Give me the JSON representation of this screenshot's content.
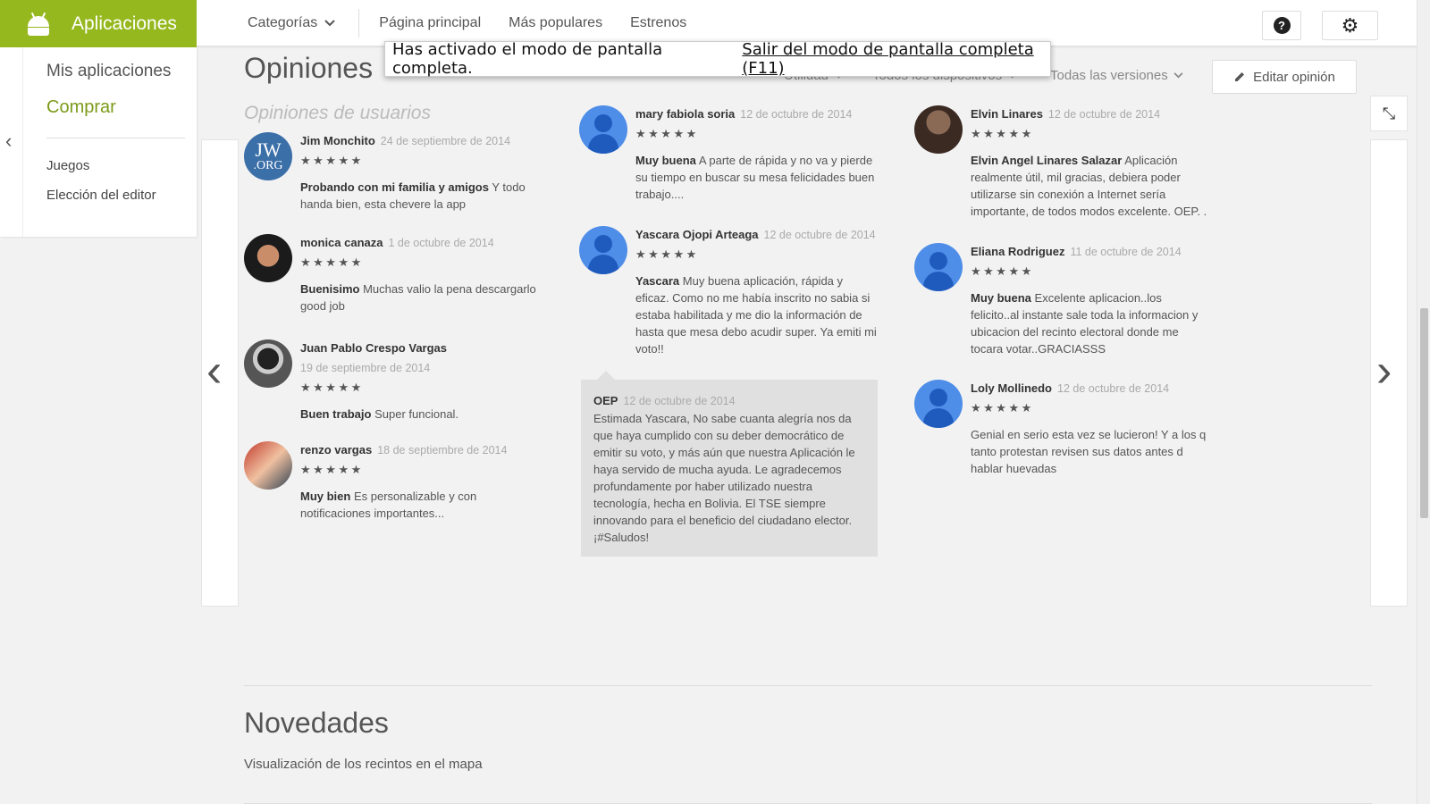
{
  "header": {
    "app_title": "Aplicaciones",
    "nav": {
      "categories": "Categorías",
      "home": "Página principal",
      "popular": "Más populares",
      "new": "Estrenos"
    },
    "help_icon": "?",
    "gear_icon": "⚙"
  },
  "sidebar": {
    "my_apps": "Mis aplicaciones",
    "shop": "Comprar",
    "games": "Juegos",
    "editors_choice": "Elección del editor"
  },
  "reviews": {
    "title": "Opiniones",
    "filters": {
      "sort": "Utilidad",
      "devices": "Todos los dispositivos",
      "versions": "Todas las versiones"
    },
    "edit_button": "Editar opinión",
    "users_heading": "Opiniones de usuarios",
    "stars": "★★★★★",
    "items": [
      {
        "name": "Jim Monchito",
        "date": "24 de septiembre de 2014",
        "lead": "Probando con mi familia y amigos",
        "text": "Y todo handa bien, esta chevere la app",
        "avatar_l1": "JW",
        "avatar_l2": ".ORG"
      },
      {
        "name": "monica canaza",
        "date": "1 de octubre de 2014",
        "lead": "Buenisimo",
        "text": "Muchas valio la pena descargarlo good job"
      },
      {
        "name": "Juan Pablo Crespo Vargas",
        "date": "19 de septiembre de 2014",
        "lead": "Buen trabajo",
        "text": "Super funcional."
      },
      {
        "name": "renzo vargas",
        "date": "18 de septiembre de 2014",
        "lead": "Muy bien",
        "text": "Es personalizable y con notificaciones importantes..."
      },
      {
        "name": "mary fabiola soria",
        "date": "12 de octubre de 2014",
        "lead": "Muy buena",
        "text": "A parte de rápida y no va y pierde su tiempo en buscar su mesa felicidades buen trabajo...."
      },
      {
        "name": "Yascara Ojopi Arteaga",
        "date": "12 de octubre de 2014",
        "lead": "Yascara",
        "text": "Muy buena aplicación, rápida y eficaz. Como no me había inscrito no sabia si estaba habilitada y me dio la información de hasta que mesa debo acudir super. Ya emiti mi voto!!"
      },
      {
        "name": "Elvin Linares",
        "date": "12 de octubre de 2014",
        "lead": "Elvin Angel Linares Salazar",
        "text": "Aplicación realmente útil, mil gracias, debiera poder utilizarse sin conexión a Internet sería importante, de todos modos excelente. OEP. ."
      },
      {
        "name": "Eliana Rodriguez",
        "date": "11 de octubre de 2014",
        "lead": "Muy buena",
        "text": "Excelente aplicacion..los felicito..al instante sale toda la informacion y ubicacion del recinto electoral donde me tocara votar..GRACIASSS"
      },
      {
        "name": "Loly Mollinedo",
        "date": "12 de octubre de 2014",
        "lead": "",
        "text": "Genial en serio esta vez se lucieron! Y a los q tanto protestan revisen sus datos antes d hablar huevadas"
      }
    ],
    "developer_reply": {
      "name": "OEP",
      "date": "12 de octubre de 2014",
      "text": "Estimada Yascara, No sabe cuanta alegría nos da que haya cumplido con su deber democrático de emitir su voto, y más aún que nuestra Aplicación le haya servido de mucha ayuda. Le agradecemos profundamente por haber utilizado nuestra tecnología, hecha en Bolivia. El TSE siempre innovando para el beneficio del ciudadano elector. ¡#Saludos!"
    }
  },
  "fullscreen_notice": {
    "message": "Has activado el modo de pantalla completa.",
    "exit": "Salir del modo de pantalla completa (F11)"
  },
  "whats_new": {
    "title": "Novedades",
    "text": "Visualización de los recintos en el mapa"
  },
  "colors": {
    "brand": "#96b81f",
    "shop_accent": "#7c9b1a",
    "avatar_blue": "#4e8de8"
  }
}
